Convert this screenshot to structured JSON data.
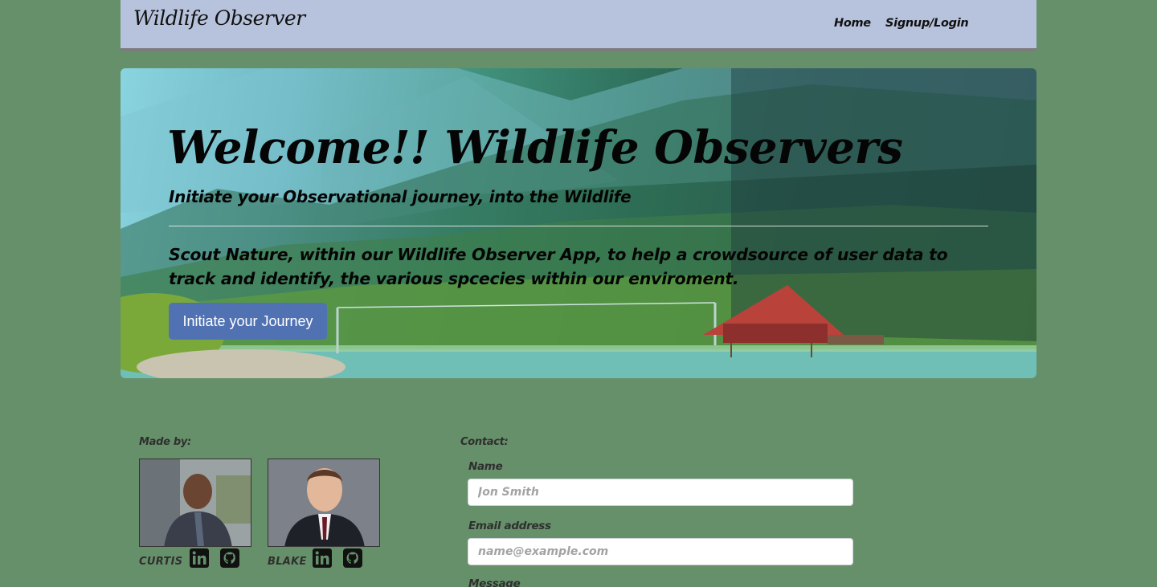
{
  "navbar": {
    "brand": "Wildlife Observer",
    "links": [
      {
        "label": "Home"
      },
      {
        "label": "Signup/Login"
      }
    ]
  },
  "hero": {
    "title": "Welcome!! Wildlife Observers",
    "subtitle": "Initiate your Observational journey, into the Wildlife",
    "description": "Scout Nature, within our Wildlife Observer App, to help a crowdsource of user data to track and identify, the various spcecies within our enviroment.",
    "button_label": "Initiate your Journey"
  },
  "footer": {
    "made_by_label": "Made by:",
    "authors": [
      {
        "name": "CURTIS",
        "icons": [
          "linkedin-icon",
          "github-icon"
        ]
      },
      {
        "name": "BLAKE",
        "icons": [
          "linkedin-icon",
          "github-icon"
        ]
      }
    ],
    "contact": {
      "label": "Contact:",
      "name_label": "Name",
      "name_placeholder": "Jon Smith",
      "email_label": "Email address",
      "email_placeholder": "name@example.com",
      "message_label": "Message"
    }
  },
  "colors": {
    "page_background": "#66906a",
    "navbar_background": "#b7c3dc",
    "button_primary": "#5072b3"
  }
}
